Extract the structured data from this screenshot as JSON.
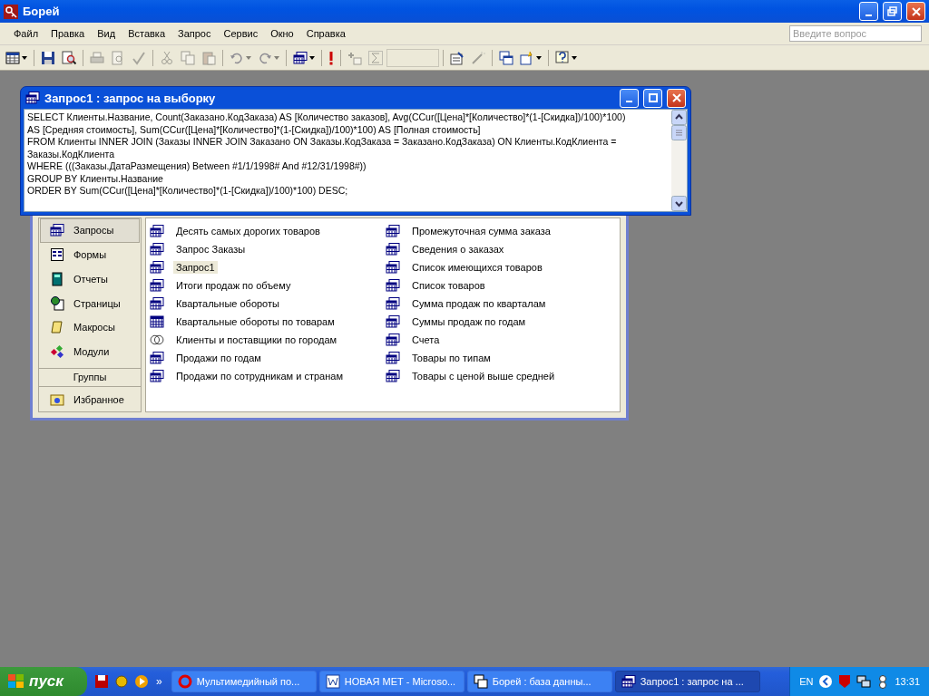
{
  "window": {
    "title": "Борей"
  },
  "menu": [
    "Файл",
    "Правка",
    "Вид",
    "Вставка",
    "Запрос",
    "Сервис",
    "Окно",
    "Справка"
  ],
  "help_box": {
    "placeholder": "Введите вопрос"
  },
  "toolbar": [
    {
      "kind": "view",
      "disabled": false,
      "menu_arrow": true
    },
    {
      "kind": "separator"
    },
    {
      "kind": "save",
      "disabled": false
    },
    {
      "kind": "search",
      "disabled": false
    },
    {
      "kind": "separator"
    },
    {
      "kind": "print",
      "disabled": true
    },
    {
      "kind": "preview",
      "disabled": true
    },
    {
      "kind": "spell",
      "disabled": true
    },
    {
      "kind": "separator"
    },
    {
      "kind": "cut",
      "disabled": true
    },
    {
      "kind": "copy",
      "disabled": true
    },
    {
      "kind": "paste",
      "disabled": true
    },
    {
      "kind": "separator"
    },
    {
      "kind": "undo",
      "disabled": true,
      "menu_arrow": true
    },
    {
      "kind": "redo",
      "disabled": true,
      "menu_arrow": true
    },
    {
      "kind": "separator"
    },
    {
      "kind": "querytype",
      "disabled": false,
      "menu_arrow": true
    },
    {
      "kind": "separator"
    },
    {
      "kind": "run",
      "disabled": false
    },
    {
      "kind": "separator"
    },
    {
      "kind": "showtable",
      "disabled": true
    },
    {
      "kind": "sum",
      "disabled": true
    },
    {
      "kind": "combo",
      "disabled": true
    },
    {
      "kind": "separator"
    },
    {
      "kind": "properties",
      "disabled": false
    },
    {
      "kind": "build",
      "disabled": true
    },
    {
      "kind": "separator"
    },
    {
      "kind": "dbwindow",
      "disabled": false
    },
    {
      "kind": "newobject",
      "disabled": false,
      "menu_arrow": true
    },
    {
      "kind": "separator"
    },
    {
      "kind": "help",
      "disabled": false,
      "menu_arrow": true
    }
  ],
  "query_window": {
    "title": "Запрос1 : запрос на выборку",
    "sql_lines": [
      "SELECT Клиенты.Название, Count(Заказано.КодЗаказа) AS [Количество заказов], Avg(CCur([Цена]*[Количество]*(1-[Скидка])/100)*100)",
      "AS [Средняя стоимость], Sum(CCur([Цена]*[Количество]*(1-[Скидка])/100)*100) AS [Полная стоимость]",
      "FROM Клиенты INNER JOIN (Заказы INNER JOIN Заказано ON Заказы.КодЗаказа = Заказано.КодЗаказа) ON Клиенты.КодКлиента =",
      "Заказы.КодКлиента",
      "WHERE (((Заказы.ДатаРазмещения) Between #1/1/1998# And #12/31/1998#))",
      "GROUP BY Клиенты.Название",
      "ORDER BY Sum(CCur([Цена]*[Количество]*(1-[Скидка])/100)*100) DESC;"
    ]
  },
  "database_window": {
    "objects": [
      {
        "kind": "queries",
        "label": "Запросы",
        "selected": true
      },
      {
        "kind": "forms",
        "label": "Формы",
        "selected": false
      },
      {
        "kind": "reports",
        "label": "Отчеты",
        "selected": false
      },
      {
        "kind": "pages",
        "label": "Страницы",
        "selected": false
      },
      {
        "kind": "macros",
        "label": "Макросы",
        "selected": false
      },
      {
        "kind": "modules",
        "label": "Модули",
        "selected": false
      }
    ],
    "groups_header": "Группы",
    "groups": [
      {
        "kind": "favorites",
        "label": "Избранное",
        "selected": false
      }
    ],
    "items": [
      {
        "kind": "select",
        "label": "Десять самых дорогих товаров",
        "selected": false
      },
      {
        "kind": "select",
        "label": "Запрос Заказы",
        "selected": false
      },
      {
        "kind": "select",
        "label": "Запрос1",
        "selected": true
      },
      {
        "kind": "select",
        "label": "Итоги продаж по объему",
        "selected": false
      },
      {
        "kind": "select",
        "label": "Квартальные обороты",
        "selected": false
      },
      {
        "kind": "crosstab",
        "label": "Квартальные обороты по товарам",
        "selected": false
      },
      {
        "kind": "union",
        "label": "Клиенты и поставщики по городам",
        "selected": false
      },
      {
        "kind": "select",
        "label": "Продажи по годам",
        "selected": false
      },
      {
        "kind": "select",
        "label": "Продажи по сотрудникам и странам",
        "selected": false
      },
      {
        "kind": "select",
        "label": "Промежуточная сумма заказа",
        "selected": false
      },
      {
        "kind": "select",
        "label": "Сведения о заказах",
        "selected": false
      },
      {
        "kind": "select",
        "label": "Список имеющихся товаров",
        "selected": false
      },
      {
        "kind": "select",
        "label": "Список товаров",
        "selected": false
      },
      {
        "kind": "select",
        "label": "Сумма продаж по кварталам",
        "selected": false
      },
      {
        "kind": "select",
        "label": "Суммы продаж по годам",
        "selected": false
      },
      {
        "kind": "select",
        "label": "Счета",
        "selected": false
      },
      {
        "kind": "select",
        "label": "Товары по типам",
        "selected": false
      },
      {
        "kind": "select",
        "label": "Товары с ценой выше средней",
        "selected": false
      }
    ]
  },
  "taskbar": {
    "start": "пуск",
    "more": "»",
    "tasks": [
      {
        "kind": "browser",
        "label": "Мультимедийный по...",
        "selected": false
      },
      {
        "kind": "word",
        "label": "НОВАЯ МЕТ - Microso...",
        "selected": false
      },
      {
        "kind": "database",
        "label": "Борей : база данны...",
        "selected": false
      },
      {
        "kind": "query",
        "label": "Запрос1 : запрос на ...",
        "selected": true
      }
    ],
    "language": "EN",
    "clock": "13:31"
  }
}
